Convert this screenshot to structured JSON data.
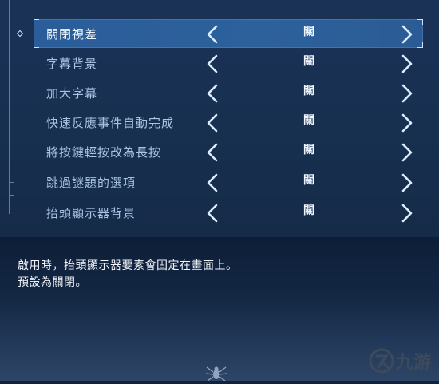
{
  "menu": {
    "options": [
      {
        "label": "關閉視差",
        "value": "關"
      },
      {
        "label": "字幕背景",
        "value": "關"
      },
      {
        "label": "加大字幕",
        "value": "關"
      },
      {
        "label": "快速反應事件自動完成",
        "value": "關"
      },
      {
        "label": "將按鍵輕按改為長按",
        "value": "關"
      },
      {
        "label": "跳過謎題的選項",
        "value": "關"
      },
      {
        "label": "抬頭顯示器背景",
        "value": "關"
      }
    ]
  },
  "description": {
    "line1": "啟用時，抬頭顯示器要素會固定在畫面上。",
    "line2": "預設為關閉。"
  },
  "watermark": {
    "text": "九游"
  },
  "colors": {
    "accent": "#2d619c",
    "arrow": "#dcecff",
    "panel": "#17304f"
  }
}
